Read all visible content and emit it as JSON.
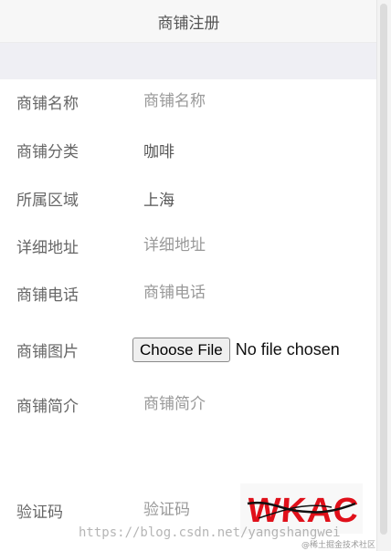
{
  "header": {
    "title": "商铺注册"
  },
  "form": {
    "name": {
      "label": "商铺名称",
      "placeholder": "商铺名称"
    },
    "category": {
      "label": "商铺分类",
      "value": "咖啡"
    },
    "region": {
      "label": "所属区域",
      "value": "上海"
    },
    "address": {
      "label": "详细地址",
      "placeholder": "详细地址"
    },
    "phone": {
      "label": "商铺电话",
      "placeholder": "商铺电话"
    },
    "image": {
      "label": "商铺图片",
      "button": "Choose File",
      "status": "No file chosen"
    },
    "intro": {
      "label": "商铺简介",
      "placeholder": "商铺简介"
    },
    "captcha": {
      "label": "验证码",
      "placeholder": "验证码",
      "image_text": "WKAC"
    }
  },
  "watermark": {
    "url": "https://blog.csdn.net/yangshangwei",
    "badge": "@稀土掘金技术社区"
  },
  "colors": {
    "captcha_text": "#e0101a",
    "captcha_stroke": "#111111"
  }
}
